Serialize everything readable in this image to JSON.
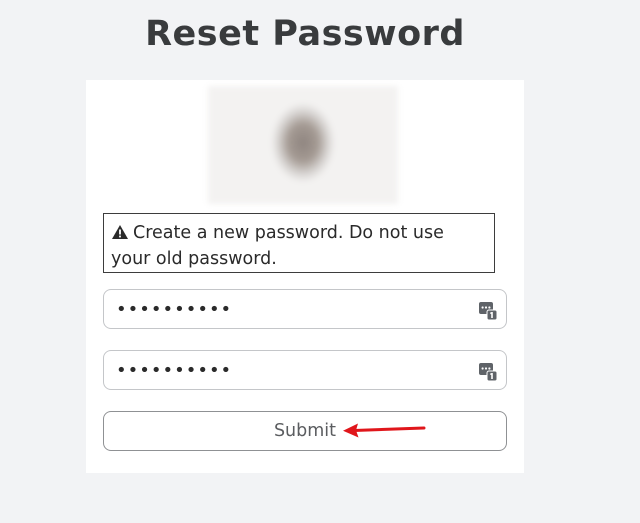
{
  "page": {
    "title": "Reset Password"
  },
  "notice": {
    "icon": "warning-triangle-icon",
    "text": "Create a new password. Do not use your old password."
  },
  "form": {
    "new_password": {
      "value": "••••••••••",
      "type": "password",
      "icon": "password-manager-icon"
    },
    "confirm_password": {
      "value": "••••••••••",
      "type": "password",
      "icon": "password-manager-icon"
    },
    "submit_label": "Submit"
  },
  "annotation": {
    "arrow_color": "#e0161b",
    "arrow_target": "submit-button"
  },
  "colors": {
    "background": "#f2f3f5",
    "card": "#ffffff",
    "title": "#393b3d",
    "field_border": "#c4c6c9"
  }
}
